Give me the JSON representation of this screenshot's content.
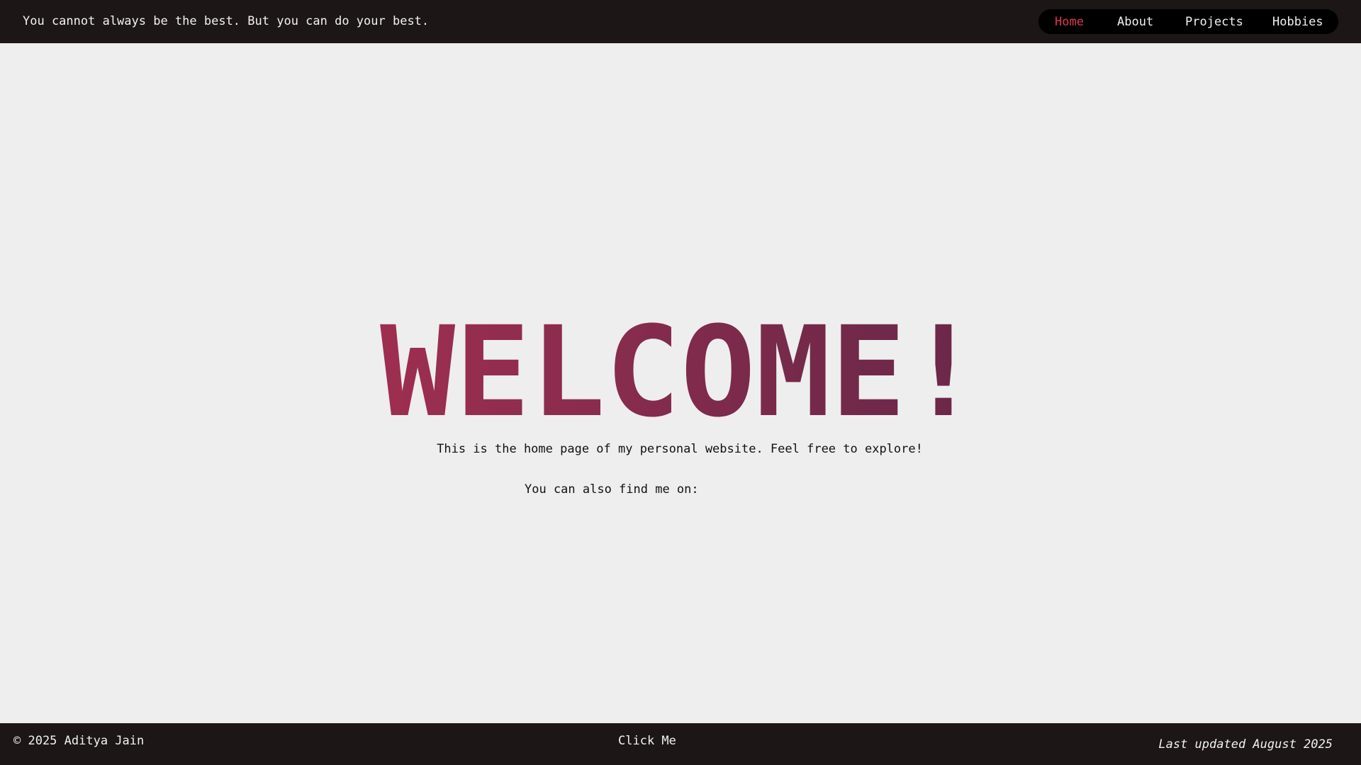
{
  "header": {
    "quote": "You cannot always be the best. But you can do your best.",
    "nav": {
      "home": "Home",
      "about": "About",
      "projects": "Projects",
      "hobbies": "Hobbies"
    }
  },
  "main": {
    "heading": "WELCOME!",
    "intro": "This is the home page of my personal website. Feel free to explore!",
    "find_me": "You can also find me on:"
  },
  "footer": {
    "copyright": "© 2025 Aditya Jain",
    "click_me": "Click Me",
    "updated": "Last updated August 2025"
  },
  "colors": {
    "header_bg": "#1c1616",
    "nav_bg": "#000000",
    "active_nav": "#d9394f",
    "page_bg": "#eeeeee",
    "heading_gradient_start": "#c73350",
    "heading_gradient_end": "#5a2545"
  }
}
